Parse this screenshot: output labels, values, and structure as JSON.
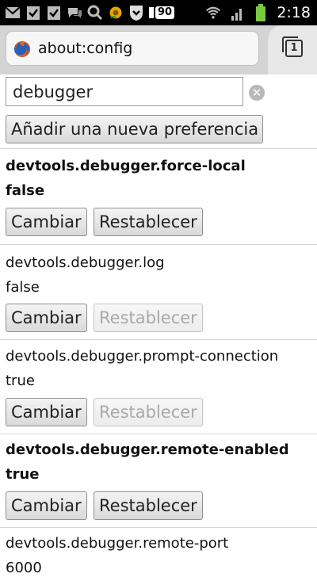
{
  "status_bar": {
    "time": "2:18",
    "notification_count": "90",
    "icons": [
      "gmail-icon",
      "checklist-icon",
      "checklist-icon",
      "chat-icon",
      "search-icon",
      "gear-sun-icon",
      "shield-icon",
      "notification-badge-icon",
      "wifi-icon",
      "signal-icon",
      "battery-icon"
    ]
  },
  "toolbar": {
    "url": "about:config",
    "tabs_count": "1"
  },
  "search": {
    "value": "debugger"
  },
  "add_pref_label": "Añadir una nueva preferencia",
  "prefs": [
    {
      "name": "devtools.debugger.force-local",
      "value": "false",
      "modified": true,
      "change_label": "Cambiar",
      "reset_label": "Restablecer",
      "reset_enabled": true
    },
    {
      "name": "devtools.debugger.log",
      "value": "false",
      "modified": false,
      "change_label": "Cambiar",
      "reset_label": "Restablecer",
      "reset_enabled": false
    },
    {
      "name": "devtools.debugger.prompt-connection",
      "value": "true",
      "modified": false,
      "change_label": "Cambiar",
      "reset_label": "Restablecer",
      "reset_enabled": false
    },
    {
      "name": "devtools.debugger.remote-enabled",
      "value": "true",
      "modified": true,
      "change_label": "Cambiar",
      "reset_label": "Restablecer",
      "reset_enabled": true
    },
    {
      "name": "devtools.debugger.remote-port",
      "value": "6000",
      "modified": false
    }
  ],
  "colors": {
    "toolbar_bg": "#d4d4d4",
    "status_bar_bg": "#000000",
    "battery_green": "#7ac943"
  }
}
